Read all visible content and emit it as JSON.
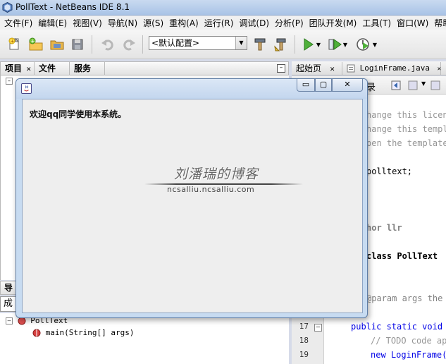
{
  "window": {
    "title": "PollText - NetBeans IDE 8.1"
  },
  "menu": [
    "文件(F)",
    "编辑(E)",
    "视图(V)",
    "导航(N)",
    "源(S)",
    "重构(A)",
    "运行(R)",
    "调试(D)",
    "分析(P)",
    "团队开发(M)",
    "工具(T)",
    "窗口(W)",
    "帮助("
  ],
  "toolbar": {
    "buttons": [
      "new-file-icon",
      "new-project-icon",
      "open-project-icon",
      "save-all-icon",
      "undo-icon",
      "redo-icon",
      "build-icon",
      "clean-build-icon",
      "run-icon",
      "debug-icon",
      "profile-icon"
    ],
    "config_value": "<默认配置>"
  },
  "left_panel": {
    "tabs": [
      {
        "label": "项目",
        "close": "✕"
      },
      {
        "label": "文件"
      },
      {
        "label": "服务"
      }
    ]
  },
  "navigator": {
    "tab_label": "导",
    "members_label": "成",
    "tree": [
      {
        "label": "PollText"
      },
      {
        "label": "main(String[] args)"
      }
    ]
  },
  "editor": {
    "tabs": [
      {
        "label": "起始页",
        "close": "✕"
      },
      {
        "label": "LoginFrame.java",
        "close": "✕"
      }
    ],
    "toolbar_label": "录",
    "lines": [
      {
        "n": "",
        "text": "hange this licens",
        "style": "cmt"
      },
      {
        "n": "",
        "text": "hange this templ",
        "style": "cmt"
      },
      {
        "n": "",
        "text": "pen the template",
        "style": "cmt"
      },
      {
        "n": "",
        "text": "polltext;",
        "style": ""
      },
      {
        "n": "",
        "text": "hor llr",
        "style": "tag"
      },
      {
        "n": "",
        "text": "class PollText",
        "style": "cls"
      },
      {
        "n": "",
        "text": "@param args the",
        "style": "param"
      },
      {
        "n": "17",
        "text": "public static void m",
        "style": "kw"
      },
      {
        "n": "18",
        "text": "// TODO code app",
        "style": "cmt"
      },
      {
        "n": "19",
        "text": "new LoginFrame()",
        "style": "kw"
      }
    ]
  },
  "dialog": {
    "welcome_text": "欢迎qq同学使用本系统。",
    "controls": {
      "minimize": "▭",
      "maximize": "▢",
      "close": "✕"
    }
  },
  "watermark": {
    "title": "刘潘瑞的博客",
    "url": "ncsalliu.ncsalliu.com"
  }
}
